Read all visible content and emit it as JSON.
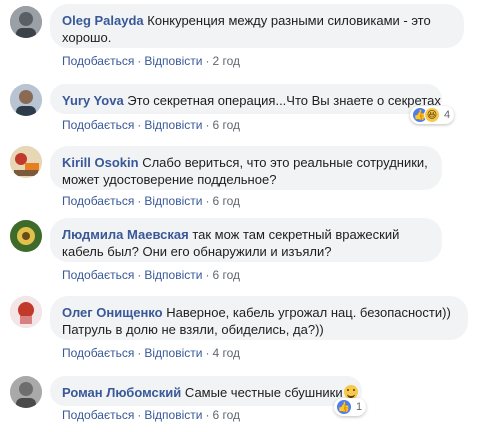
{
  "actions": {
    "like": "Подобається",
    "reply": "Відповісти",
    "sep": "·"
  },
  "comments": [
    {
      "author": "Oleg Palayda",
      "text": "Конкуренция между разными силовиками - это хорошо.",
      "time": "2 год"
    },
    {
      "author": "Yury Yova",
      "text": "Это секретная операция...Что Вы знаете о секретах...",
      "time": "6 год",
      "reaction_count": "4",
      "reaction_icons": [
        "like-icon",
        "haha-icon"
      ]
    },
    {
      "author": "Kirill Osokin",
      "text": "Слабо вериться, что это реальные сотрудники, может удостоверение поддельное?",
      "time": "6 год"
    },
    {
      "author": "Людмила Маевская",
      "text": "так мож там секретный вражеский кабель был? Они его обнаружили и изъяли?",
      "time": "6 год"
    },
    {
      "author": "Олег Онищенко",
      "text": "Наверное, кабель угрожал нац. безопасности)) Патруль в долю не взяли, обиделись, да?))",
      "time": "4 год"
    },
    {
      "author": "Роман Любомский",
      "text": "Самые честные сбушники",
      "time": "6 год",
      "reaction_count": "1",
      "reaction_icons": [
        "like-icon"
      ]
    }
  ],
  "colors": {
    "author": "#385898",
    "bubble": "#f2f3f5",
    "meta": "#606770",
    "like_blue": "#4a7ef2"
  }
}
